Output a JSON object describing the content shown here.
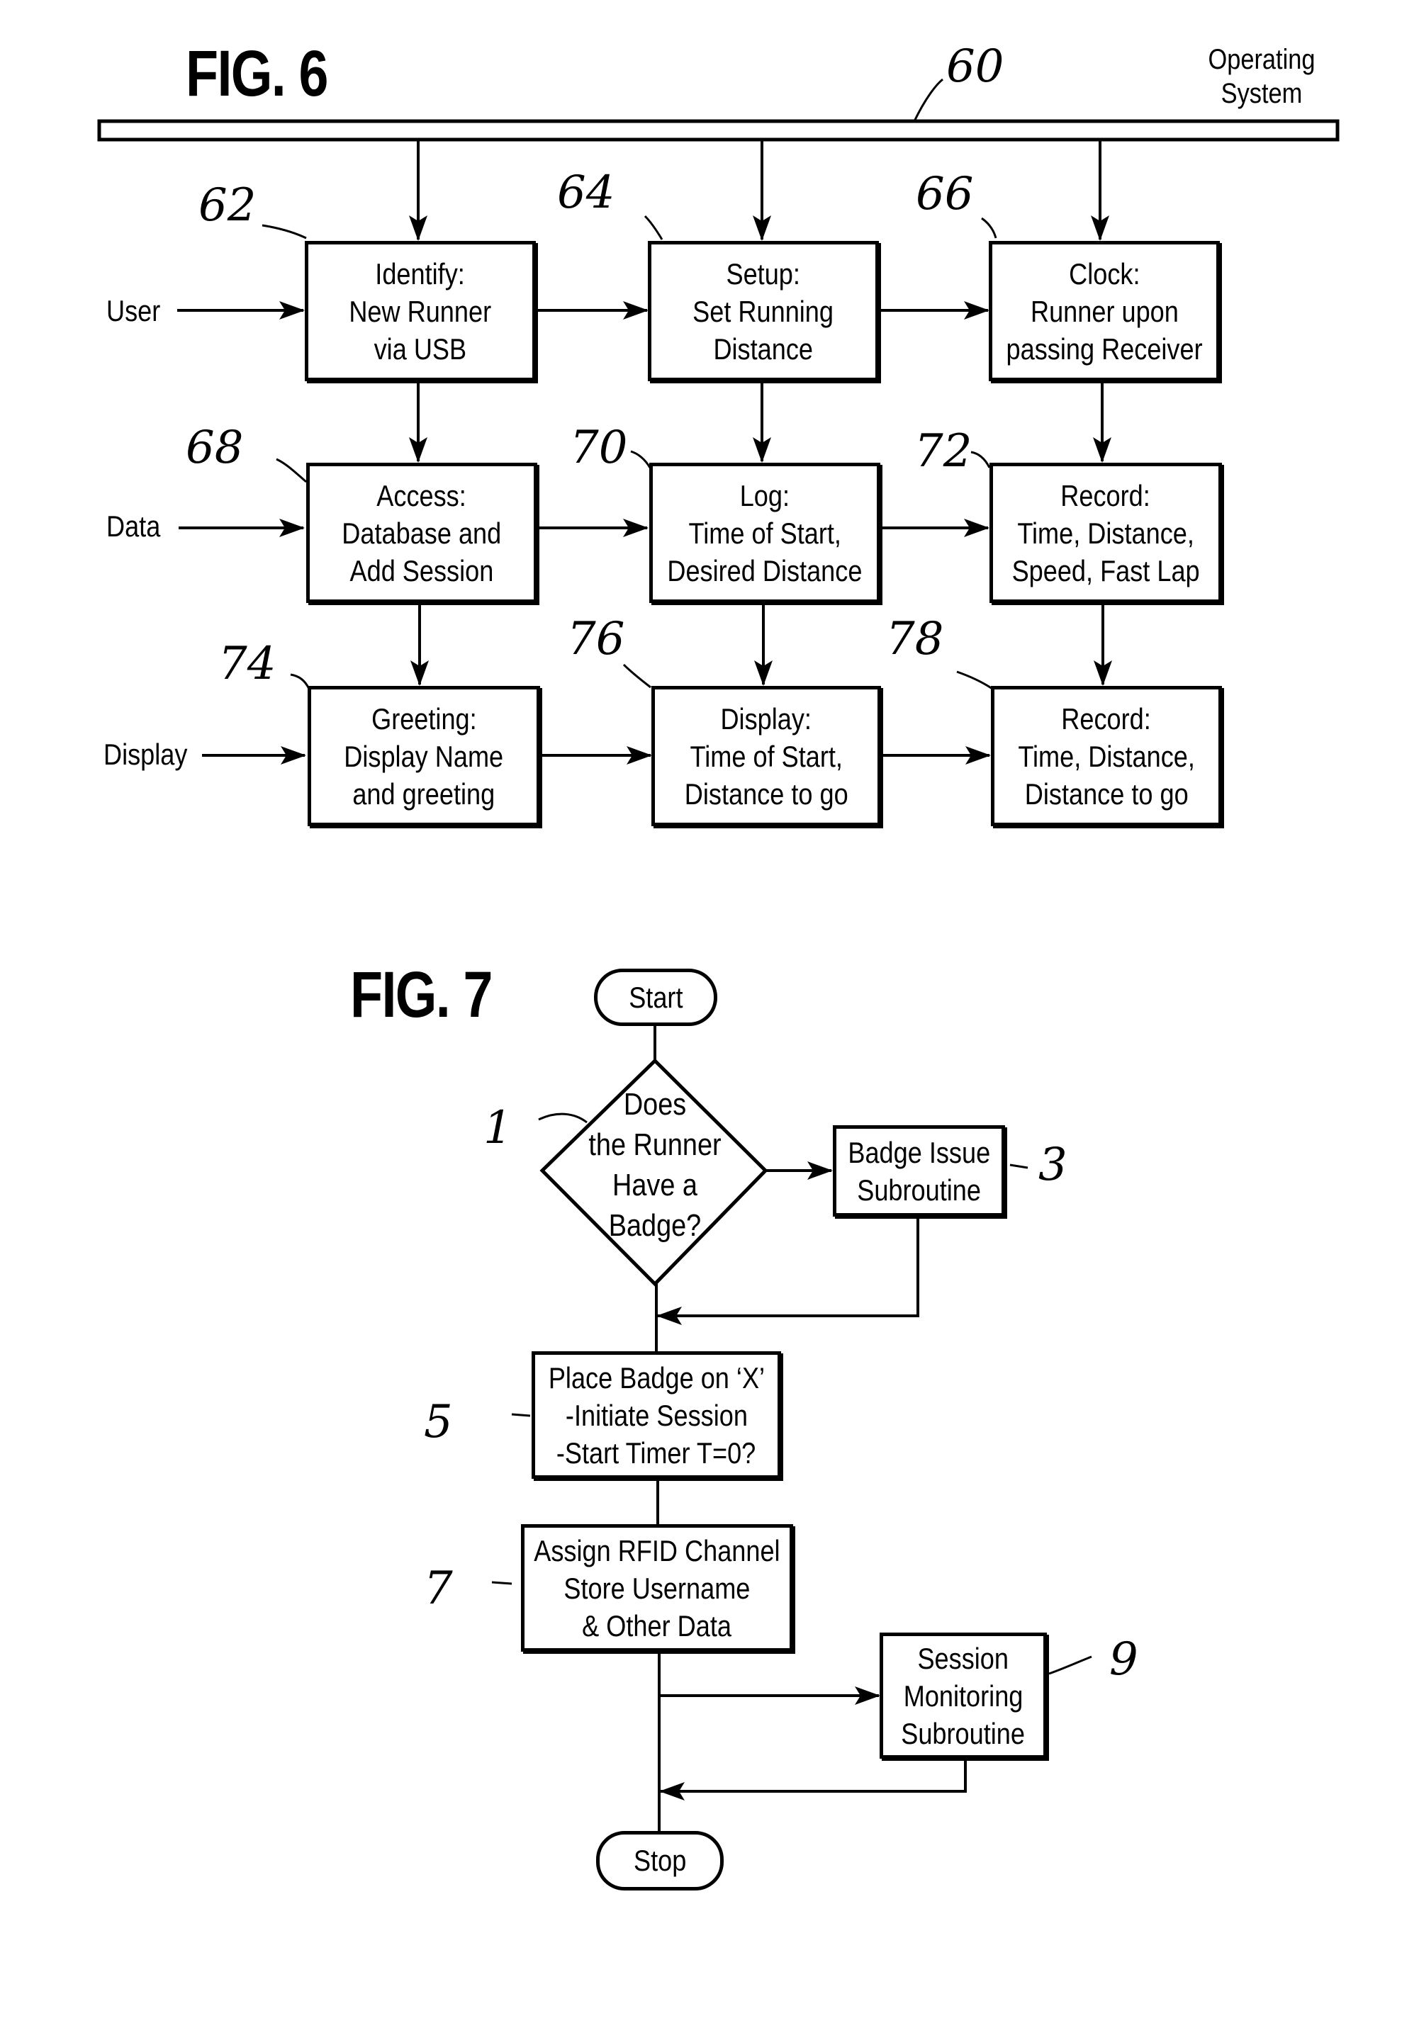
{
  "fig6": {
    "title": "FIG. 6",
    "bus_label": [
      "Operating",
      "System"
    ],
    "bus_ref": "60",
    "row_inputs": [
      "User",
      "Data",
      "Display"
    ],
    "boxes": [
      {
        "ref": "62",
        "lines": [
          "Identify:",
          "New Runner",
          "via USB"
        ]
      },
      {
        "ref": "64",
        "lines": [
          "Setup:",
          "Set Running",
          "Distance"
        ]
      },
      {
        "ref": "66",
        "lines": [
          "Clock:",
          "Runner upon",
          "passing Receiver"
        ]
      },
      {
        "ref": "68",
        "lines": [
          "Access:",
          "Database and",
          "Add Session"
        ]
      },
      {
        "ref": "70",
        "lines": [
          "Log:",
          "Time of Start,",
          "Desired Distance"
        ]
      },
      {
        "ref": "72",
        "lines": [
          "Record:",
          "Time, Distance,",
          "Speed, Fast Lap"
        ]
      },
      {
        "ref": "74",
        "lines": [
          "Greeting:",
          "Display Name",
          "and greeting"
        ]
      },
      {
        "ref": "76",
        "lines": [
          "Display:",
          "Time of Start,",
          "Distance to go"
        ]
      },
      {
        "ref": "78",
        "lines": [
          "Record:",
          "Time, Distance,",
          "Distance to go"
        ]
      }
    ]
  },
  "fig7": {
    "title": "FIG. 7",
    "start_label": "Start",
    "stop_label": "Stop",
    "decision": {
      "ref": "1",
      "lines": [
        "Does",
        "the Runner",
        "Have a",
        "Badge?"
      ]
    },
    "badge_issue": {
      "ref": "3",
      "lines": [
        "Badge Issue",
        "Subroutine"
      ]
    },
    "place_badge": {
      "ref": "5",
      "lines": [
        "Place Badge on ‘X’",
        "-Initiate Session",
        "-Start Timer T=0?"
      ]
    },
    "assign_rfid": {
      "ref": "7",
      "lines": [
        "Assign RFID Channel",
        "Store Username",
        "& Other Data"
      ]
    },
    "session_monitoring": {
      "ref": "9",
      "lines": [
        "Session",
        "Monitoring",
        "Subroutine"
      ]
    }
  }
}
